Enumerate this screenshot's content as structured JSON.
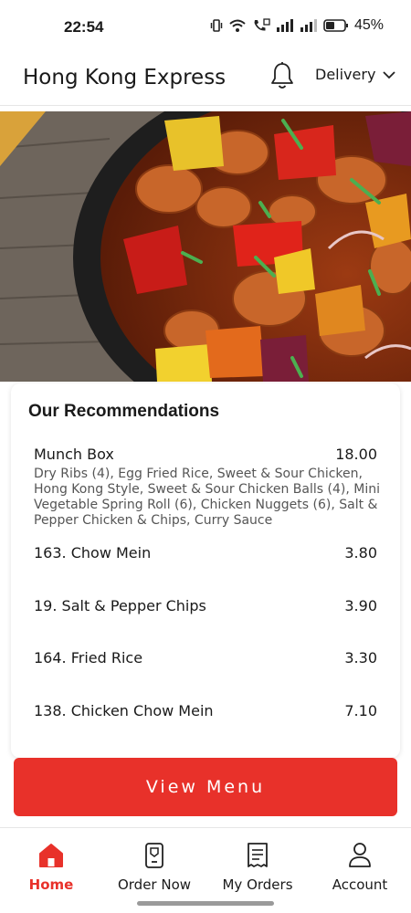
{
  "status_bar": {
    "time": "22:54",
    "battery": "45%"
  },
  "header": {
    "title": "Hong Kong Express",
    "order_type": "Delivery",
    "bell_icon": "bell-icon",
    "dropdown_icon": "chevron-down-icon"
  },
  "recommendations": {
    "title": "Our Recommendations",
    "items": [
      {
        "name": "Munch Box",
        "price": "18.00",
        "description": "Dry Ribs (4), Egg Fried Rice, Sweet & Sour Chicken, Hong Kong Style, Sweet & Sour Chicken Balls (4), Mini Vegetable Spring Roll (6), Chicken Nuggets (6), Salt & Pepper Chicken & Chips,  Curry Sauce"
      },
      {
        "name": "163. Chow Mein",
        "price": "3.80"
      },
      {
        "name": "19. Salt & Pepper Chips",
        "price": "3.90"
      },
      {
        "name": "164. Fried Rice",
        "price": "3.30"
      },
      {
        "name": "138. Chicken Chow Mein",
        "price": "7.10"
      }
    ]
  },
  "view_menu_label": "View Menu",
  "bottom_nav": [
    {
      "label": "Home",
      "icon": "home-icon",
      "active": true
    },
    {
      "label": "Order Now",
      "icon": "order-icon",
      "active": false
    },
    {
      "label": "My Orders",
      "icon": "receipt-icon",
      "active": false
    },
    {
      "label": "Account",
      "icon": "user-icon",
      "active": false
    }
  ],
  "colors": {
    "accent": "#e8312a",
    "text": "#1a1a1a",
    "muted": "#555555"
  }
}
